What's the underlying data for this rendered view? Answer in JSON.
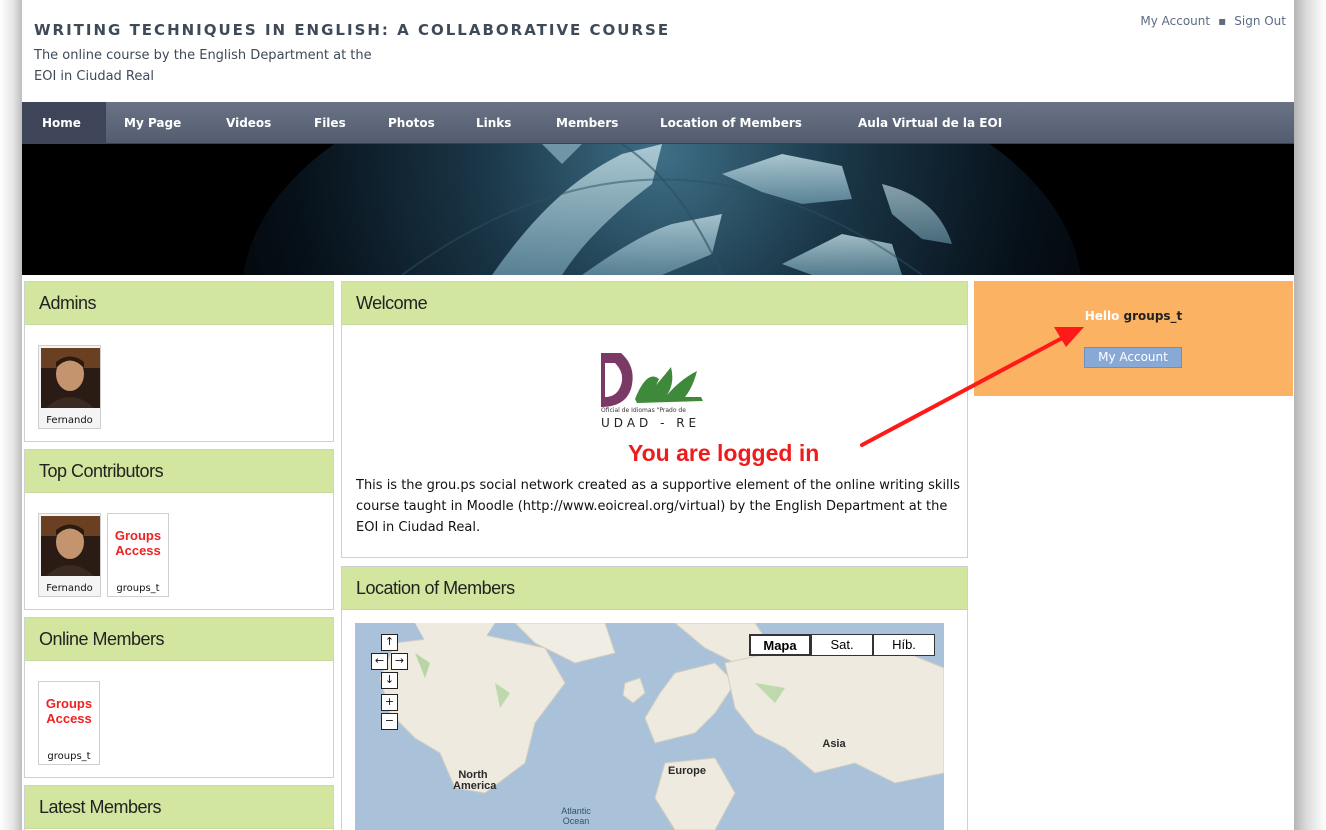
{
  "header": {
    "title": "WRITING TECHNIQUES IN ENGLISH: A COLLABORATIVE COURSE",
    "subtitle_line1": "The online course by the English Department at the",
    "subtitle_line2": "EOI in Ciudad Real",
    "my_account": "My Account",
    "sign_out": "Sign Out"
  },
  "nav": {
    "items": [
      {
        "label": "Home",
        "active": true
      },
      {
        "label": "My Page"
      },
      {
        "label": "Videos"
      },
      {
        "label": "Files"
      },
      {
        "label": "Photos"
      },
      {
        "label": "Links"
      },
      {
        "label": "Members"
      },
      {
        "label": "Location of Members"
      },
      {
        "label": "Aula Virtual de la EOI"
      }
    ]
  },
  "sidebar": {
    "admins": {
      "title": "Admins",
      "members": [
        {
          "name": "Fernando"
        }
      ]
    },
    "top_contributors": {
      "title": "Top Contributors",
      "members": [
        {
          "name": "Fernando"
        },
        {
          "name": "groups_t",
          "placeholder": "Groups Access"
        }
      ]
    },
    "online_members": {
      "title": "Online Members",
      "members": [
        {
          "name": "groups_t",
          "placeholder": "Groups Access"
        }
      ]
    },
    "latest_members": {
      "title": "Latest Members"
    }
  },
  "welcome": {
    "title": "Welcome",
    "logo_line1": "Oficial de Idiomas \"Prado de",
    "logo_line2": "UDAD - RE",
    "text": "This is the grou.ps social network created as a supportive element of the online writing skills course taught in Moodle (http://www.eoicreal.org/virtual) by the English Department at the EOI in Ciudad Real."
  },
  "annotation": "You are logged in",
  "location": {
    "title": "Location of Members",
    "map_types": [
      "Mapa",
      "Sat.",
      "Híb."
    ],
    "selected_map_type": "Mapa",
    "labels": {
      "north_america": "North\nAmerica",
      "europe": "Europe",
      "asia": "Asia",
      "atlantic": "Atlantic\nOcean"
    }
  },
  "user_box": {
    "hello": "Hello",
    "username": "groups_t",
    "button": "My Account"
  },
  "colors": {
    "nav_bg": "#5f6679",
    "box_header": "#d3e6a0",
    "user_box": "#fbb262",
    "annotation": "#ee1c1c"
  }
}
